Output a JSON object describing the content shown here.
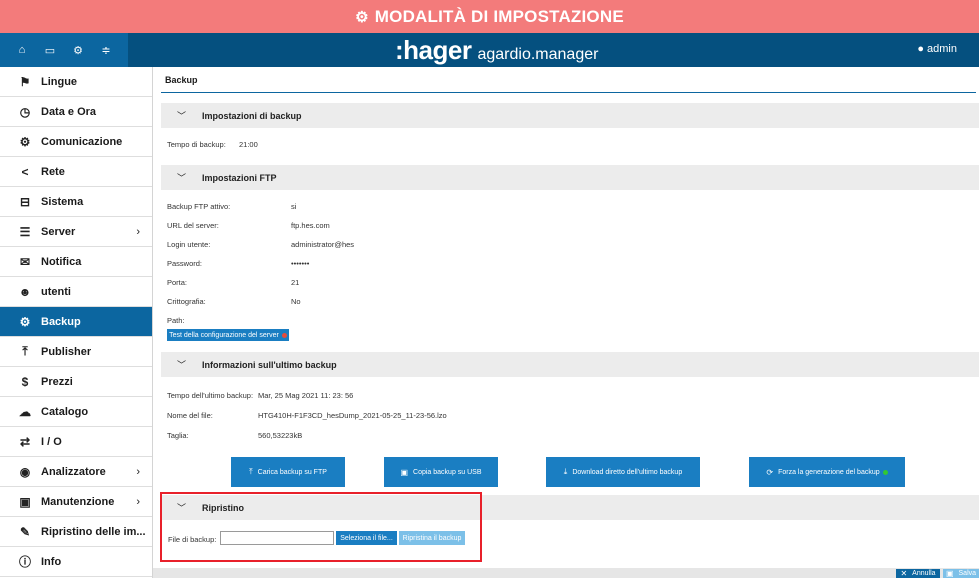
{
  "banner": {
    "icon": "gears-icon",
    "title": "MODALITÀ DI IMPOSTAZIONE"
  },
  "header": {
    "quick_icons": [
      "home-icon",
      "monitor-icon",
      "gears-icon",
      "sliders-icon"
    ],
    "brand": ":hager",
    "product": "agardio.manager",
    "user": "admin"
  },
  "sidebar": {
    "items": [
      {
        "label": "Lingue",
        "icon": "flag-icon"
      },
      {
        "label": "Data e Ora",
        "icon": "clock-icon"
      },
      {
        "label": "Comunicazione",
        "icon": "gears-icon"
      },
      {
        "label": "Rete",
        "icon": "share-icon"
      },
      {
        "label": "Sistema",
        "icon": "drive-icon"
      },
      {
        "label": "Server",
        "icon": "server-icon",
        "chevron": "›"
      },
      {
        "label": "Notifica",
        "icon": "envelope-icon"
      },
      {
        "label": "utenti",
        "icon": "users-icon"
      },
      {
        "label": "Backup",
        "icon": "gears-icon",
        "active": true
      },
      {
        "label": "Publisher",
        "icon": "upload-icon"
      },
      {
        "label": "Prezzi",
        "icon": "dollar-icon"
      },
      {
        "label": "Catalogo",
        "icon": "cloud-icon"
      },
      {
        "label": "I / O",
        "icon": "exchange-icon"
      },
      {
        "label": "Analizzatore",
        "icon": "eye-icon",
        "chevron": "›"
      },
      {
        "label": "Manutenzione",
        "icon": "toolbox-icon",
        "chevron": "›"
      },
      {
        "label": "Ripristino delle im...",
        "icon": "wrench-icon"
      },
      {
        "label": "Info",
        "icon": "info-icon"
      }
    ]
  },
  "main": {
    "breadcrumb": "Backup",
    "backup_settings": {
      "title": "Impostazioni di backup",
      "time_label": "Tempo di backup:",
      "time_value": "21:00"
    },
    "ftp": {
      "title": "Impostazioni FTP",
      "rows": [
        {
          "label": "Backup FTP attivo:",
          "value": "si"
        },
        {
          "label": "URL del server:",
          "value": "ftp.hes.com"
        },
        {
          "label": "Login utente:",
          "value": "administrator@hes"
        },
        {
          "label": "Password:",
          "value": "•••••••"
        },
        {
          "label": "Porta:",
          "value": "21"
        },
        {
          "label": "Crittografia:",
          "value": "No"
        },
        {
          "label": "Path:",
          "value": ""
        }
      ],
      "test_button": "Test della configurazione del server"
    },
    "last_backup": {
      "title": "Informazioni sull'ultimo backup",
      "time_label": "Tempo dell'ultimo backup:",
      "time_value": "Mar, 25 Mag 2021 11: 23: 56",
      "file_label": "Nome del file:",
      "file_value": "HTG410H-F1F3CD_hesDump_2021-05-25_11-23-56.lzo",
      "size_label": "Taglia:",
      "size_value": "560,53223kB"
    },
    "actions": {
      "ftp_upload": "Carica backup su FTP",
      "usb_copy": "Copia backup su USB",
      "download_last": "Download diretto dell'ultimo backup",
      "force_generate": "Forza la generazione del backup"
    },
    "restore": {
      "title": "Ripristino",
      "file_label": "File di backup:",
      "file_value": "",
      "select_button": "Seleziona il file...",
      "restore_button": "Ripristina il backup"
    },
    "footer": {
      "cancel": "Annulla",
      "save": "Salva"
    }
  },
  "colors": {
    "banner": "#f37b7b",
    "header": "#05507f",
    "accent": "#1a7ec2",
    "highlight_box": "#e8202a"
  }
}
